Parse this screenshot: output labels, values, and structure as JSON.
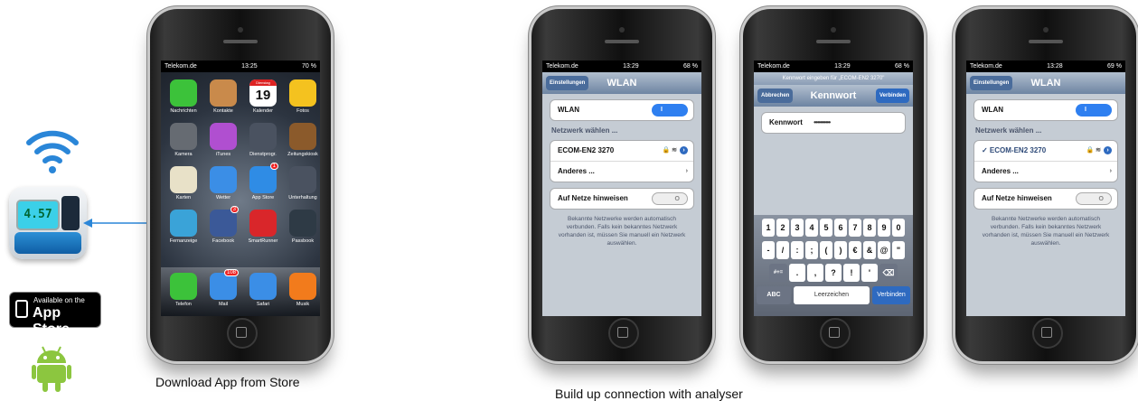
{
  "left_panel": {
    "device_display": "4.57",
    "app_store_small": "Available on the",
    "app_store_big": "App Store"
  },
  "captions": {
    "download": "Download App from Store",
    "connect": "Build up connection with analyser"
  },
  "phone1": {
    "status_carrier": "Telekom.de",
    "status_time": "13:25",
    "status_battery": "70 %",
    "calendar_weekday": "Dienstag",
    "calendar_day": "19",
    "apps": [
      {
        "label": "Nachrichten",
        "icon": "messages-icon",
        "color": "#3cc23a"
      },
      {
        "label": "Kontakte",
        "icon": "contacts-icon",
        "color": "#c98a4b"
      },
      {
        "label": "Kalender",
        "icon": "calendar-icon",
        "color": "#ffffff"
      },
      {
        "label": "Fotos",
        "icon": "photos-icon",
        "color": "#f4c21f"
      },
      {
        "label": "Kamera",
        "icon": "camera-icon",
        "color": "#666b72"
      },
      {
        "label": "iTunes",
        "icon": "itunes-icon",
        "color": "#b04fd0"
      },
      {
        "label": "Dienstprogr.",
        "icon": "utilities-folder-icon",
        "color": "#4a5260"
      },
      {
        "label": "Zeitungskiosk",
        "icon": "newsstand-icon",
        "color": "#8b5a2b"
      },
      {
        "label": "Karten",
        "icon": "maps-icon",
        "color": "#e8e1c8"
      },
      {
        "label": "Wetter",
        "icon": "weather-icon",
        "color": "#3b8ee6"
      },
      {
        "label": "App Store",
        "icon": "appstore-icon",
        "color": "#2f8ce5",
        "badge": "1"
      },
      {
        "label": "Unterhaltung",
        "icon": "entertainment-folder-icon",
        "color": "#4a5260"
      },
      {
        "label": "Fernanzeige",
        "icon": "remote-display-app-icon",
        "color": "#3aa3d8"
      },
      {
        "label": "Facebook",
        "icon": "facebook-icon",
        "color": "#3b5998",
        "badge": "3"
      },
      {
        "label": "SmartRunner",
        "icon": "smartrunner-icon",
        "color": "#d9262a"
      },
      {
        "label": "Passbook",
        "icon": "passbook-icon",
        "color": "#2e3a45"
      }
    ],
    "dock": [
      {
        "label": "Telefon",
        "icon": "phone-icon",
        "color": "#3cc23a"
      },
      {
        "label": "Mail",
        "icon": "mail-icon",
        "color": "#3b8ee6",
        "badge": "108"
      },
      {
        "label": "Safari",
        "icon": "safari-icon",
        "color": "#3b8ee6"
      },
      {
        "label": "Musik",
        "icon": "music-icon",
        "color": "#f27b1c"
      }
    ]
  },
  "phone2": {
    "status_carrier": "Telekom.de",
    "status_time": "13:29",
    "status_battery": "68 %",
    "back_button": "Einstellungen",
    "title": "WLAN",
    "wlan_label": "WLAN",
    "toggle_on": "I",
    "networks_header": "Netzwerk wählen ...",
    "network_name": "ECOM-EN2  3270",
    "other_label": "Anderes ...",
    "ask_label": "Auf Netze hinweisen",
    "toggle_off": "O",
    "note": "Bekannte Netzwerke werden automatisch verbunden. Falls kein bekanntes Netzwerk vorhanden ist, müssen Sie manuell ein Netzwerk auswählen."
  },
  "phone3": {
    "status_carrier": "Telekom.de",
    "status_time": "13:29",
    "status_battery": "68 %",
    "prompt": "Kennwort eingeben für „ECOM-EN2  3270\"",
    "cancel_button": "Abbrechen",
    "title": "Kennwort",
    "connect_button": "Verbinden",
    "password_label": "Kennwort",
    "password_value": "••••••••••",
    "keys_row1": [
      "1",
      "2",
      "3",
      "4",
      "5",
      "6",
      "7",
      "8",
      "9",
      "0"
    ],
    "keys_row2": [
      "-",
      "/",
      ":",
      ";",
      "(",
      ")",
      "€",
      "&",
      "@",
      "\""
    ],
    "keys_row3": [
      ".",
      ",",
      "?",
      "!",
      "'"
    ],
    "shift_key": "#+=",
    "delete_key": "⌫",
    "abc_key": "ABC",
    "space_key": "Leerzeichen",
    "enter_key": "Verbinden"
  },
  "phone4": {
    "status_carrier": "Telekom.de",
    "status_time": "13:28",
    "status_battery": "69 %",
    "back_button": "Einstellungen",
    "title": "WLAN",
    "wlan_label": "WLAN",
    "toggle_on": "I",
    "networks_header": "Netzwerk wählen ...",
    "network_name": "✓ ECOM-EN2  3270",
    "other_label": "Anderes ...",
    "ask_label": "Auf Netze hinweisen",
    "toggle_off": "O",
    "note": "Bekannte Netzwerke werden automatisch verbunden. Falls kein bekanntes Netzwerk vorhanden ist, müssen Sie manuell ein Netzwerk auswählen."
  }
}
